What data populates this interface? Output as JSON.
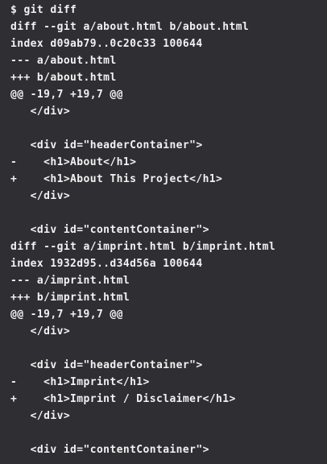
{
  "terminal": {
    "lines": [
      "$ git diff",
      "diff --git a/about.html b/about.html",
      "index d09ab79..0c20c33 100644",
      "--- a/about.html",
      "+++ b/about.html",
      "@@ -19,7 +19,7 @@",
      "   </div>",
      "",
      "   <div id=\"headerContainer\">",
      "-    <h1>About</h1>",
      "+    <h1>About This Project</h1>",
      "   </div>",
      "",
      "   <div id=\"contentContainer\">",
      "diff --git a/imprint.html b/imprint.html",
      "index 1932d95..d34d56a 100644",
      "--- a/imprint.html",
      "+++ b/imprint.html",
      "@@ -19,7 +19,7 @@",
      "   </div>",
      "",
      "   <div id=\"headerContainer\">",
      "-    <h1>Imprint</h1>",
      "+    <h1>Imprint / Disclaimer</h1>",
      "   </div>",
      "",
      "   <div id=\"contentContainer\">"
    ]
  }
}
